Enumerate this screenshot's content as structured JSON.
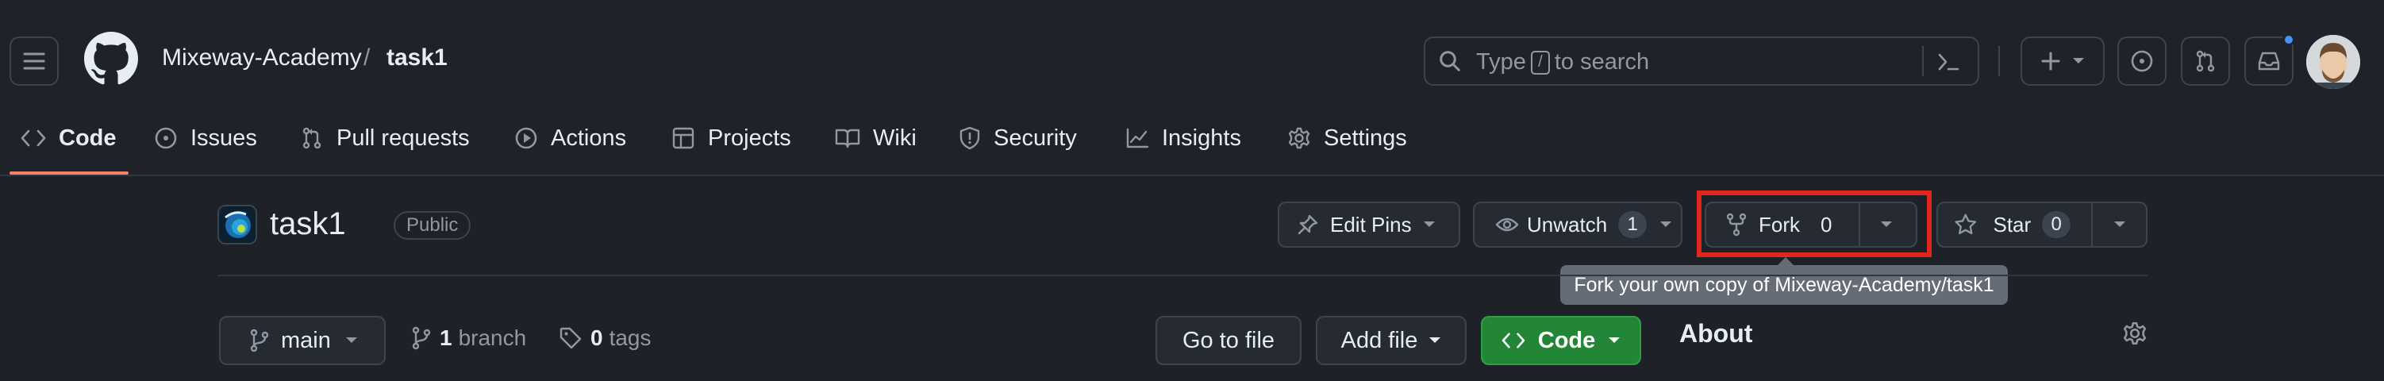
{
  "header": {
    "owner": "Mixeway-Academy",
    "separator": "/",
    "repo": "task1",
    "search": {
      "before_key": "Type",
      "key": "/",
      "after_key": "to search"
    }
  },
  "tabs": [
    {
      "label": "Code",
      "icon": "code-icon",
      "active": true
    },
    {
      "label": "Issues",
      "icon": "issue-opened-icon"
    },
    {
      "label": "Pull requests",
      "icon": "git-pull-request-icon"
    },
    {
      "label": "Actions",
      "icon": "play-icon"
    },
    {
      "label": "Projects",
      "icon": "table-icon"
    },
    {
      "label": "Wiki",
      "icon": "book-icon"
    },
    {
      "label": "Security",
      "icon": "shield-icon"
    },
    {
      "label": "Insights",
      "icon": "graph-icon"
    },
    {
      "label": "Settings",
      "icon": "gear-icon"
    }
  ],
  "repo_bar": {
    "title": "task1",
    "visibility": "Public",
    "edit_pins": "Edit Pins",
    "unwatch": {
      "label": "Unwatch",
      "count": "1"
    },
    "fork": {
      "label": "Fork",
      "count": "0"
    },
    "star": {
      "label": "Star",
      "count": "0"
    },
    "tooltip": "Fork your own copy of Mixeway-Academy/task1"
  },
  "file_bar": {
    "branch": "main",
    "branches": {
      "count": "1",
      "label": "branch"
    },
    "tags": {
      "count": "0",
      "label": "tags"
    },
    "go_to_file": "Go to file",
    "add_file": "Add file",
    "code": "Code",
    "about": "About"
  },
  "colors": {
    "accent_underline": "#f78166",
    "code_button": "#238636",
    "highlight_box": "#e1261c",
    "notification_dot": "#4493f8"
  }
}
